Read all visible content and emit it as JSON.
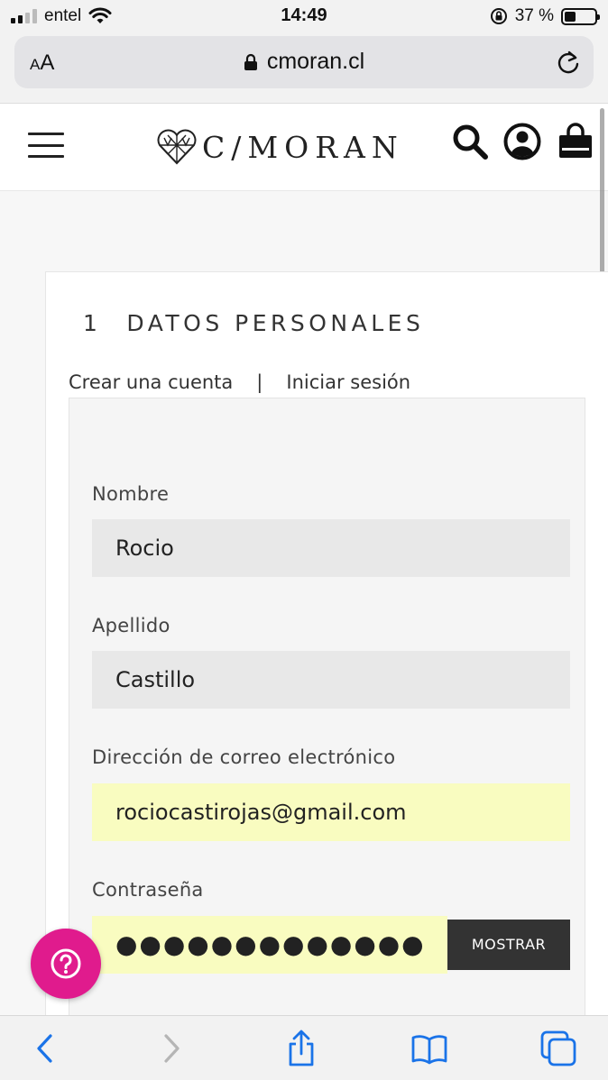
{
  "status_bar": {
    "carrier": "entel",
    "time": "14:49",
    "battery_percent": "37 %",
    "battery_level": 0.37,
    "signal_bars_on": 2
  },
  "browser": {
    "text_size_label_small": "A",
    "text_size_label_large": "A",
    "url": "cmoran.cl"
  },
  "site": {
    "logo_text": "C/MORAN",
    "accent_color": "#e01b8d"
  },
  "checkout": {
    "step_number": "1",
    "step_title": "DATOS PERSONALES",
    "tabs": {
      "create_account": "Crear una cuenta",
      "separator": "|",
      "login": "Iniciar sesión"
    },
    "form": {
      "first_name_label": "Nombre",
      "first_name_value": "Rocio",
      "last_name_label": "Apellido",
      "last_name_value": "Castillo",
      "email_label": "Dirección de correo electrónico",
      "email_value": "rociocastirojas@gmail.com",
      "password_label": "Contraseña",
      "password_value": "●●●●●●●●●●●●●",
      "show_password_button": "MOSTRAR"
    }
  },
  "icons": {
    "menu": "hamburger-icon",
    "search": "search-icon",
    "account": "user-icon",
    "cart": "shopping-bag-icon",
    "help": "question-icon",
    "back": "chevron-left-icon",
    "forward": "chevron-right-icon",
    "share": "share-icon",
    "bookmarks": "book-icon",
    "tabs": "tabs-icon"
  }
}
